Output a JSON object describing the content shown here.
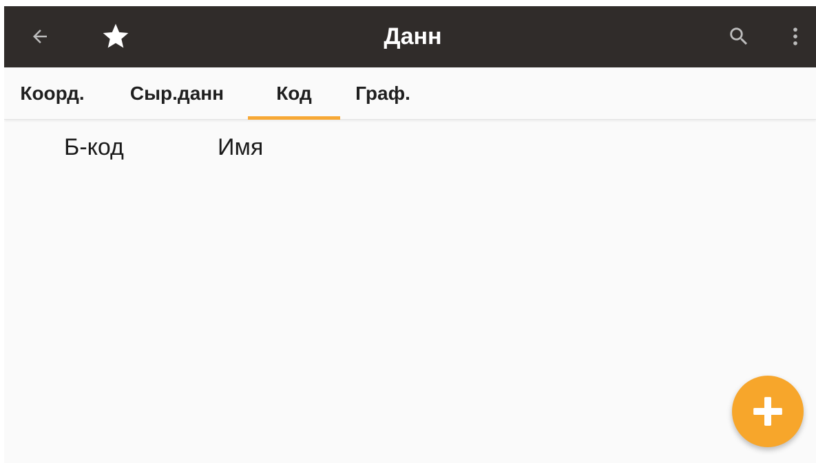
{
  "toolbar": {
    "title": "Данн",
    "icons": {
      "back": "arrow-back-icon",
      "favorite": "star-icon",
      "search": "search-icon",
      "more": "more-vert-icon"
    },
    "background_color": "#302c2a"
  },
  "tabs": [
    {
      "label": "Коорд.",
      "selected": false
    },
    {
      "label": "Сыр.данн",
      "selected": false
    },
    {
      "label": "Код",
      "selected": true
    },
    {
      "label": "Граф.",
      "selected": false
    }
  ],
  "accent_color": "#f7a835",
  "table": {
    "columns": [
      "Б-код",
      "Имя"
    ],
    "rows": []
  },
  "fab": {
    "icon": "plus-icon"
  }
}
